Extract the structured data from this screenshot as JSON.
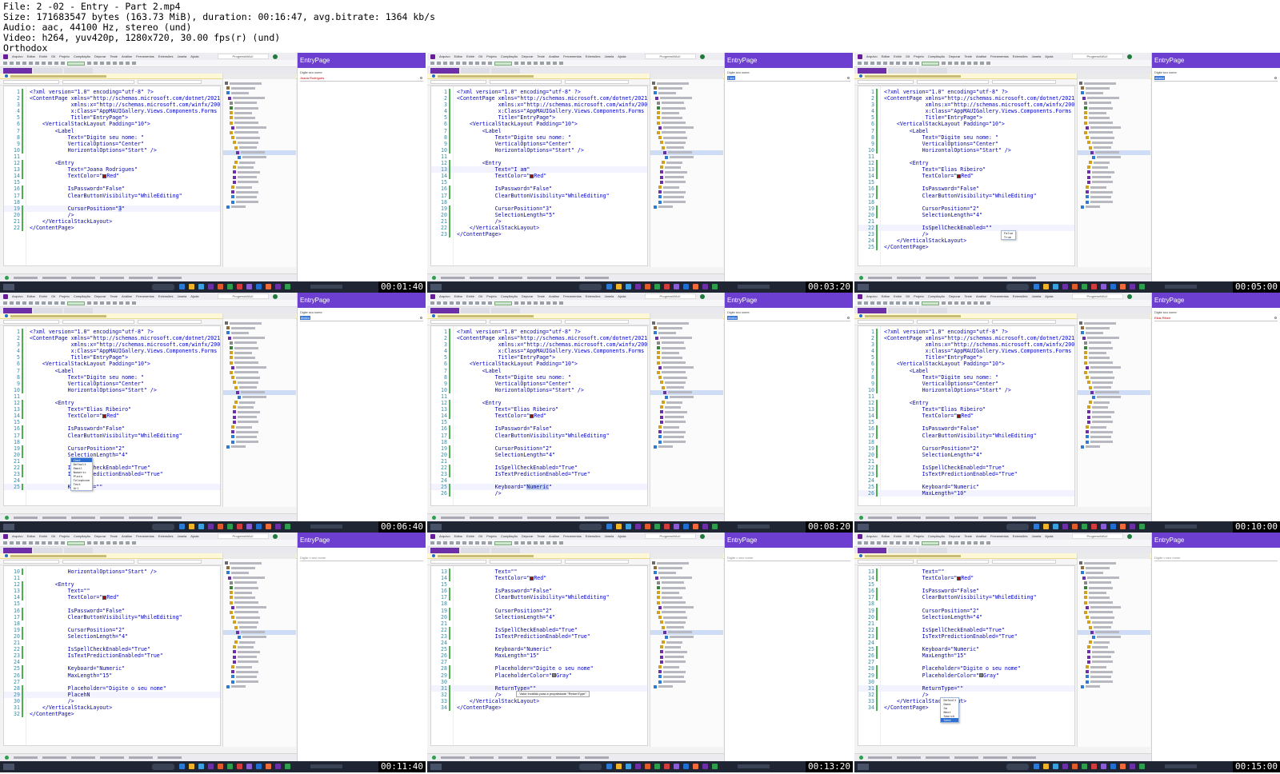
{
  "file_info": {
    "line1": "File: 2 -02 - Entry - Part 2.mp4",
    "line2": "Size: 171683547 bytes (163.73 MiB), duration: 00:16:47, avg.bitrate: 1364 kb/s",
    "line3": "Audio: aac, 44100 Hz, stereo (und)",
    "line4": "Video: h264, yuv420p, 1280x720, 30.00 fps(r) (und)",
    "line5": "Orthodox"
  },
  "colors": {
    "app_bar": "#6d3fd1",
    "xml_text": "#0000c8",
    "line_numbers": "#2b91af",
    "red_swatch": "#c00000",
    "gray_swatch": "#808080",
    "taskbar": "#1f2532"
  },
  "tiles": [
    {
      "timestamp": "00:01:40",
      "first_line": 1,
      "current_line": 19,
      "code": [
        "<?xml version=\"1.0\" encoding=\"utf-8\" ?>",
        "<ContentPage xmlns=\"http://schemas.microsoft.com/dotnet/2021",
        "             xmlns:x=\"http://schemas.microsoft.com/winfx/200",
        "             x:Class=\"AppMAUIGallery.Views.Components.Forms",
        "             Title=\"EntryPage\">",
        "    <VerticalStackLayout Padding=\"10\">",
        "        <Label",
        "            Text=\"Digite seu nome: \"",
        "            VerticalOptions=\"Center\"",
        "            HorizontalOptions=\"Start\" />",
        "",
        "        <Entry",
        "            Text=\"Joana Rodrigues\"",
        "            TextColor=\"{{red}}Red\"",
        "",
        "            IsPassword=\"False\"",
        "            ClearButtonVisibility=\"WhileEditing\"",
        "",
        "            CursorPosition=\"{{h:3}}\"",
        "            />",
        "    </VerticalStackLayout>",
        "</ContentPage>"
      ],
      "app": {
        "title": "EntryPage",
        "label": "Digite seu nome:",
        "entry_value": "Joana Rodrigues",
        "entry_selected": false,
        "placeholder": ""
      }
    },
    {
      "timestamp": "00:03:20",
      "first_line": 1,
      "current_line": 13,
      "code": [
        "<?xml version=\"1.0\" encoding=\"utf-8\" ?>",
        "<ContentPage xmlns=\"http://schemas.microsoft.com/dotnet/2021",
        "             xmlns:x=\"http://schemas.microsoft.com/winfx/200",
        "             x:Class=\"AppMAUIGallery.Views.Components.Forms",
        "             Title=\"EntryPage\">",
        "    <VerticalStackLayout Padding=\"10\">",
        "        <Label",
        "            Text=\"Digite seu nome: \"",
        "            VerticalOptions=\"Center\"",
        "            HorizontalOptions=\"Start\" />",
        "",
        "        <Entry",
        "            Text=\"I am\"",
        "            TextColor=\"{{red}}Red\"",
        "",
        "            IsPassword=\"False\"",
        "            ClearButtonVisibility=\"WhileEditing\"",
        "",
        "            CursorPosition=\"3\"",
        "            SelectionLength=\"5\"",
        "            />",
        "    </VerticalStackLayout>",
        "</ContentPage>"
      ],
      "app": {
        "title": "EntryPage",
        "label": "Digite seu nome:",
        "entry_value": "I am",
        "entry_selected": true,
        "placeholder": ""
      }
    },
    {
      "timestamp": "00:05:00",
      "first_line": 1,
      "current_line": 22,
      "code": [
        "<?xml version=\"1.0\" encoding=\"utf-8\" ?>",
        "<ContentPage xmlns=\"http://schemas.microsoft.com/dotnet/2021",
        "             xmlns:x=\"http://schemas.microsoft.com/winfx/200",
        "             x:Class=\"AppMAUIGallery.Views.Components.Forms",
        "             Title=\"EntryPage\">",
        "    <VerticalStackLayout Padding=\"10\">",
        "        <Label",
        "            Text=\"Digite seu nome: \"",
        "            VerticalOptions=\"Center\"",
        "            HorizontalOptions=\"Start\" />",
        "",
        "        <Entry",
        "            Text=\"Elias Ribeiro\"",
        "            TextColor=\"{{red}}Red\"",
        "",
        "            IsPassword=\"False\"",
        "            ClearButtonVisibility=\"WhileEditing\"",
        "",
        "            CursorPosition=\"2\"",
        "            SelectionLength=\"4\"",
        "",
        "            IsSpellCheckEnabled=\"\"",
        "            />",
        "    </VerticalStackLayout>",
        "</ContentPage>"
      ],
      "popup": {
        "line": 22,
        "col": 37,
        "items": [
          "False",
          "True"
        ],
        "selected": -1
      },
      "app": {
        "title": "EntryPage",
        "label": "Digite seu nome:",
        "entry_value": "ribeiro",
        "entry_selected": true,
        "placeholder": ""
      }
    },
    {
      "timestamp": "00:06:40",
      "first_line": 1,
      "current_line": 25,
      "code": [
        "<?xml version=\"1.0\" encoding=\"utf-8\" ?>",
        "<ContentPage xmlns=\"http://schemas.microsoft.com/dotnet/2021",
        "             xmlns:x=\"http://schemas.microsoft.com/winfx/200",
        "             x:Class=\"AppMAUIGallery.Views.Components.Forms",
        "             Title=\"EntryPage\">",
        "    <VerticalStackLayout Padding=\"10\">",
        "        <Label",
        "            Text=\"Digite seu nome: \"",
        "            VerticalOptions=\"Center\"",
        "            HorizontalOptions=\"Start\" />",
        "",
        "        <Entry",
        "            Text=\"Elias Ribeiro\"",
        "            TextColor=\"{{red}}Red\"",
        "",
        "            IsPassword=\"False\"",
        "            ClearButtonVisibility=\"WhileEditing\"",
        "",
        "            CursorPosition=\"2\"",
        "            SelectionLength=\"4\"",
        "",
        "            IsSpellCheckEnabled=\"True\"",
        "            IsTextPredictionEnabled=\"True\"",
        "",
        "            Keyboard=\"\""
      ],
      "popup": {
        "line": 20,
        "col": 13,
        "items": [
          "Chat",
          "Default",
          "Email",
          "Numeric",
          "Plain",
          "Telephone",
          "Text",
          "Url"
        ],
        "selected": 0
      },
      "app": {
        "title": "EntryPage",
        "label": "Digite seu nome:",
        "entry_value": "ribeiro",
        "entry_selected": true,
        "placeholder": ""
      }
    },
    {
      "timestamp": "00:08:20",
      "first_line": 1,
      "current_line": 25,
      "code": [
        "<?xml version=\"1.0\" encoding=\"utf-8\" ?>",
        "<ContentPage xmlns=\"http://schemas.microsoft.com/dotnet/2021",
        "             xmlns:x=\"http://schemas.microsoft.com/winfx/200",
        "             x:Class=\"AppMAUIGallery.Views.Components.Forms",
        "             Title=\"EntryPage\">",
        "    <VerticalStackLayout Padding=\"10\">",
        "        <Label",
        "            Text=\"Digite seu nome: \"",
        "            VerticalOptions=\"Center\"",
        "            HorizontalOptions=\"Start\" />",
        "",
        "        <Entry",
        "            Text=\"Elias Ribeiro\"",
        "            TextColor=\"{{red}}Red\"",
        "",
        "            IsPassword=\"False\"",
        "            ClearButtonVisibility=\"WhileEditing\"",
        "",
        "            CursorPosition=\"2\"",
        "            SelectionLength=\"4\"",
        "",
        "            IsSpellCheckEnabled=\"True\"",
        "            IsTextPredictionEnabled=\"True\"",
        "",
        "            Keyboard=\"{{h:Numeric}}\"",
        "            />"
      ],
      "app": {
        "title": "EntryPage",
        "label": "Digite seu nome:",
        "entry_value": "ribeiro",
        "entry_selected": true,
        "placeholder": ""
      }
    },
    {
      "timestamp": "00:10:00",
      "first_line": 1,
      "current_line": 26,
      "code": [
        "<?xml version=\"1.0\" encoding=\"utf-8\" ?>",
        "<ContentPage xmlns=\"http://schemas.microsoft.com/dotnet/2021",
        "             xmlns:x=\"http://schemas.microsoft.com/winfx/200",
        "             x:Class=\"AppMAUIGallery.Views.Components.Forms",
        "             Title=\"EntryPage\">",
        "    <VerticalStackLayout Padding=\"10\">",
        "        <Label",
        "            Text=\"Digite seu nome: \"",
        "            VerticalOptions=\"Center\"",
        "            HorizontalOptions=\"Start\" />",
        "",
        "        <Entry",
        "            Text=\"Elias Ribeiro\"",
        "            TextColor=\"{{red}}Red\"",
        "",
        "            IsPassword=\"False\"",
        "            ClearButtonVisibility=\"WhileEditing\"",
        "",
        "            CursorPosition=\"2\"",
        "            SelectionLength=\"4\"",
        "",
        "            IsSpellCheckEnabled=\"True\"",
        "            IsTextPredictionEnabled=\"True\"",
        "",
        "            Keyboard=\"Numeric\"",
        "            MaxLength=\"10\""
      ],
      "app": {
        "title": "EntryPage",
        "label": "Digite seu nome:",
        "entry_value": "Elias Ribeir",
        "entry_selected": false,
        "placeholder": ""
      }
    },
    {
      "timestamp": "00:11:40",
      "first_line": 10,
      "current_line": 29,
      "code": [
        "            HorizontalOptions=\"Start\" />",
        "",
        "        <Entry",
        "            Text=\"\"",
        "            TextColor=\"{{red}}Red\"",
        "",
        "            IsPassword=\"False\"",
        "            ClearButtonVisibility=\"WhileEditing\"",
        "",
        "            CursorPosition=\"2\"",
        "            SelectionLength=\"4\"",
        "",
        "            IsSpellCheckEnabled=\"True\"",
        "            IsTextPredictionEnabled=\"True\"",
        "",
        "            Keyboard=\"Numeric\"",
        "            MaxLength=\"15\"",
        "",
        "            Placeholder=\"Digite o seu nome\"",
        "            PlacehN",
        "            />",
        "    </VerticalStackLayout>",
        "</ContentPage>"
      ],
      "app": {
        "title": "EntryPage",
        "label": "",
        "entry_value": "",
        "entry_selected": false,
        "placeholder": "Digite o seu nome"
      }
    },
    {
      "timestamp": "00:13:20",
      "first_line": 13,
      "current_line": 31,
      "code": [
        "            Text=\"\"",
        "            TextColor=\"{{red}}Red\"",
        "",
        "            IsPassword=\"False\"",
        "            ClearButtonVisibility=\"WhileEditing\"",
        "",
        "            CursorPosition=\"2\"",
        "            SelectionLength=\"4\"",
        "",
        "            IsSpellCheckEnabled=\"True\"",
        "            IsTextPredictionEnabled=\"True\"",
        "",
        "            Keyboard=\"Numeric\"",
        "            MaxLength=\"15\"",
        "",
        "            Placeholder=\"Digite o seu nome\"",
        "            PlaceholderColor=\"{{gray}}Gray\"",
        "",
        "            ReturnType=\"\"",
        "            />",
        "    </VerticalStackLayout>",
        "</ContentPage>"
      ],
      "tooltip": {
        "line": 32,
        "col": 19,
        "text": "Valor inválido para a propriedade \"ReturnType\""
      },
      "app": {
        "title": "EntryPage",
        "label": "",
        "entry_value": "",
        "entry_selected": false,
        "placeholder": "Digite o seu nome"
      }
    },
    {
      "timestamp": "00:15:00",
      "first_line": 13,
      "current_line": 31,
      "code": [
        "            Text=\"\"",
        "            TextColor=\"{{red}}Red\"",
        "",
        "            IsPassword=\"False\"",
        "            ClearButtonVisibility=\"WhileEditing\"",
        "",
        "            CursorPosition=\"2\"",
        "            SelectionLength=\"4\"",
        "",
        "            IsSpellCheckEnabled=\"True\"",
        "            IsTextPredictionEnabled=\"True\"",
        "",
        "            Keyboard=\"Numeric\"",
        "            MaxLength=\"15\"",
        "",
        "            Placeholder=\"Digite o seu nome\"",
        "            PlaceholderColor=\"{{gray}}Gray\"",
        "",
        "            ReturnType=\"\"",
        "            />",
        "    </VerticalStackLayout>",
        "</ContentPage>"
      ],
      "popup": {
        "line": 32,
        "col": 18,
        "items": [
          "Default",
          "Done",
          "Go",
          "Next",
          "Search",
          "Send"
        ],
        "selected": 5
      },
      "app": {
        "title": "EntryPage",
        "label": "",
        "entry_value": "",
        "entry_selected": false,
        "placeholder": "Digite o seu nome"
      }
    }
  ]
}
